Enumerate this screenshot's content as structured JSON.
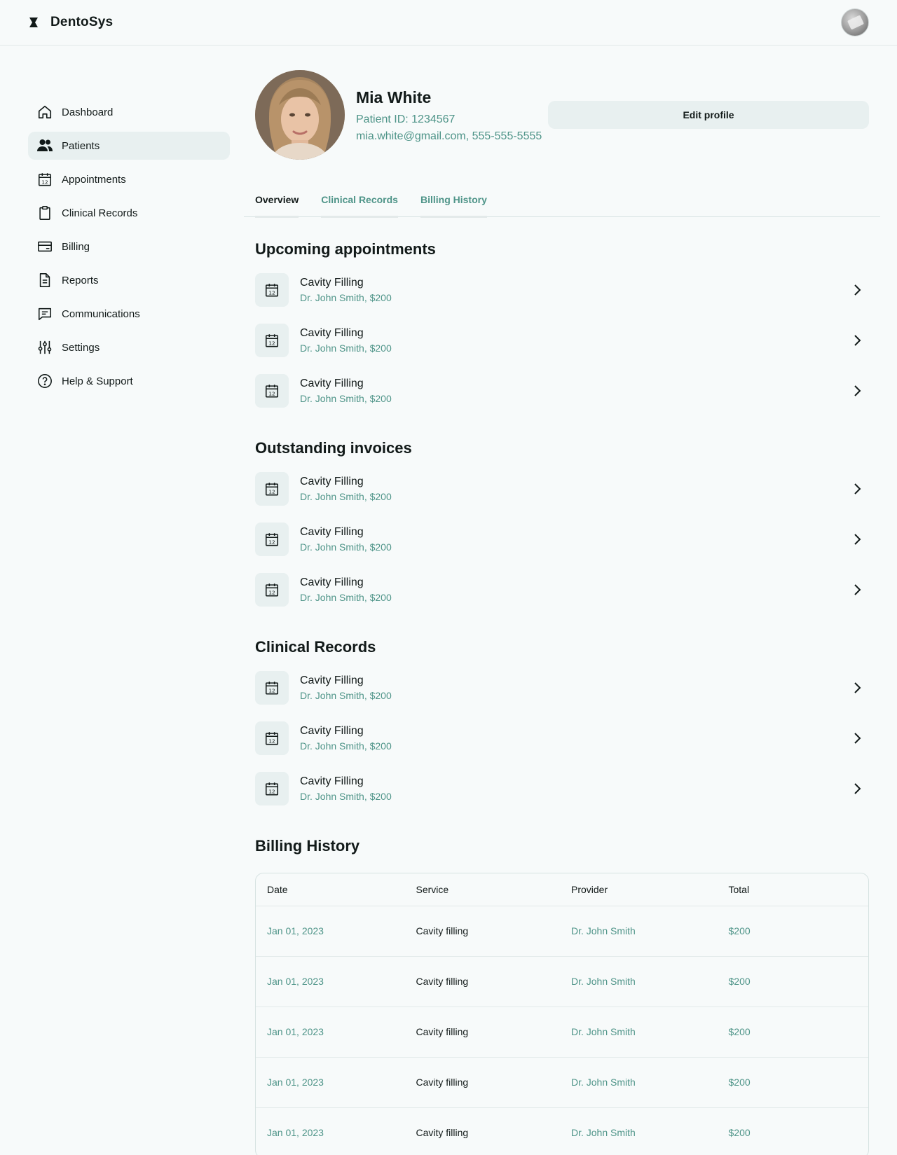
{
  "app": {
    "name": "DentoSys"
  },
  "sidebar": {
    "items": [
      {
        "label": "Dashboard",
        "icon": "home-icon"
      },
      {
        "label": "Patients",
        "icon": "users-icon",
        "active": true
      },
      {
        "label": "Appointments",
        "icon": "calendar-icon"
      },
      {
        "label": "Clinical Records",
        "icon": "clipboard-icon"
      },
      {
        "label": "Billing",
        "icon": "credit-card-icon"
      },
      {
        "label": "Reports",
        "icon": "file-text-icon"
      },
      {
        "label": "Communications",
        "icon": "message-icon"
      },
      {
        "label": "Settings",
        "icon": "sliders-icon"
      },
      {
        "label": "Help & Support",
        "icon": "help-circle-icon"
      }
    ]
  },
  "profile": {
    "name": "Mia White",
    "patient_id": "Patient ID: 1234567",
    "contact": "mia.white@gmail.com, 555-555-5555",
    "edit_label": "Edit profile"
  },
  "tabs": [
    {
      "label": "Overview",
      "active": true
    },
    {
      "label": "Clinical Records"
    },
    {
      "label": "Billing History"
    }
  ],
  "sections": {
    "upcoming": {
      "title": "Upcoming appointments",
      "items": [
        {
          "title": "Cavity Filling",
          "sub": "Dr. John Smith, $200"
        },
        {
          "title": "Cavity Filling",
          "sub": "Dr. John Smith, $200"
        },
        {
          "title": "Cavity Filling",
          "sub": "Dr. John Smith, $200"
        }
      ]
    },
    "invoices": {
      "title": "Outstanding invoices",
      "items": [
        {
          "title": "Cavity Filling",
          "sub": "Dr. John Smith, $200"
        },
        {
          "title": "Cavity Filling",
          "sub": "Dr. John Smith, $200"
        },
        {
          "title": "Cavity Filling",
          "sub": "Dr. John Smith, $200"
        }
      ]
    },
    "clinical": {
      "title": "Clinical Records",
      "items": [
        {
          "title": "Cavity Filling",
          "sub": "Dr. John Smith, $200"
        },
        {
          "title": "Cavity Filling",
          "sub": "Dr. John Smith, $200"
        },
        {
          "title": "Cavity Filling",
          "sub": "Dr. John Smith, $200"
        }
      ]
    }
  },
  "billing": {
    "title": "Billing History",
    "columns": [
      "Date",
      "Service",
      "Provider",
      "Total"
    ],
    "rows": [
      [
        "Jan 01, 2023",
        "Cavity filling",
        "Dr. John Smith",
        "$200"
      ],
      [
        "Jan 01, 2023",
        "Cavity filling",
        "Dr. John Smith",
        "$200"
      ],
      [
        "Jan 01, 2023",
        "Cavity filling",
        "Dr. John Smith",
        "$200"
      ],
      [
        "Jan 01, 2023",
        "Cavity filling",
        "Dr. John Smith",
        "$200"
      ],
      [
        "Jan 01, 2023",
        "Cavity filling",
        "Dr. John Smith",
        "$200"
      ]
    ]
  },
  "colors": {
    "accent": "#4e9488",
    "text": "#121a19",
    "surface": "#e8f0f0",
    "background": "#f7fafa"
  }
}
